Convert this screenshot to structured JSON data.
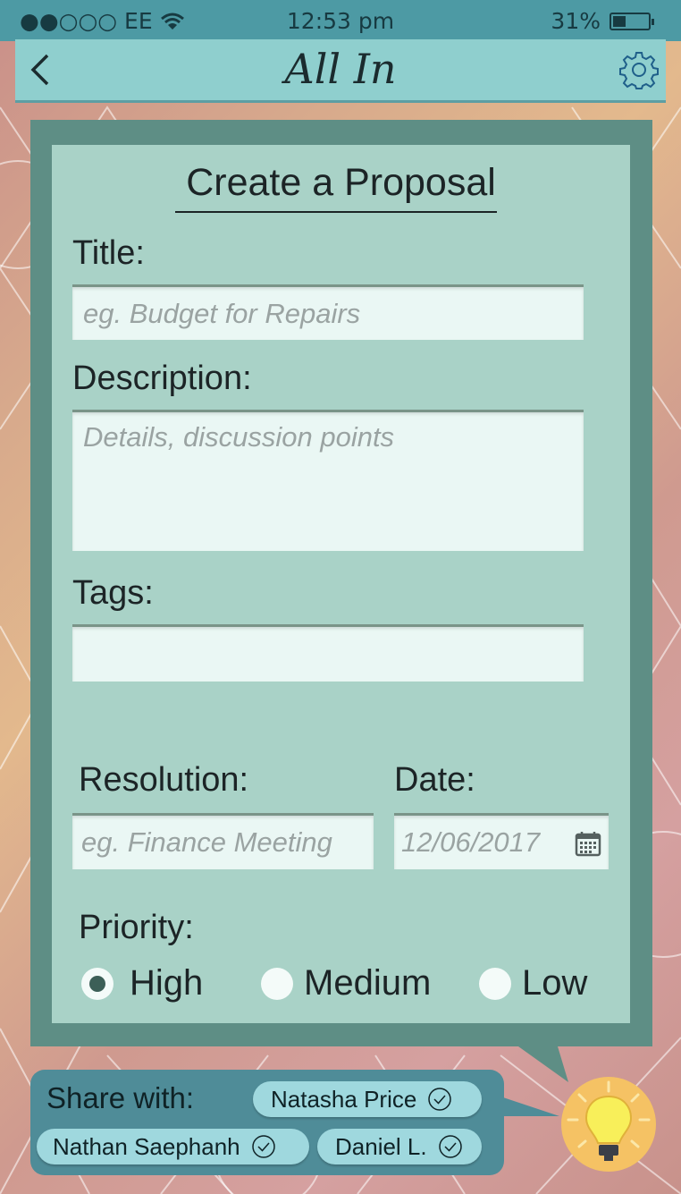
{
  "status_bar": {
    "carrier": "●●○○○ EE",
    "time": "12:53 pm",
    "battery": "31%"
  },
  "nav": {
    "title": "All In",
    "back_icon": "chevron-left-icon",
    "settings_icon": "gear-icon"
  },
  "form": {
    "heading": "Create a Proposal",
    "title_label": "Title:",
    "title_placeholder": "eg. Budget for Repairs",
    "description_label": "Description:",
    "description_placeholder": "Details, discussion points",
    "tags_label": "Tags:",
    "tags_value": "",
    "resolution_label": "Resolution:",
    "resolution_placeholder": "eg. Finance Meeting",
    "date_label": "Date:",
    "date_value": "12/06/2017",
    "priority_label": "Priority:",
    "priority_options": [
      "High",
      "Medium",
      "Low"
    ],
    "priority_selected": "High"
  },
  "share": {
    "label": "Share with:",
    "people": [
      "Natasha Price",
      "Nathan Saephanh",
      "Daniel L."
    ]
  },
  "colors": {
    "accent": "#4d9aa4",
    "card": "#a9d2c7",
    "card_border": "#5e8e85",
    "chip": "#9fd8de",
    "bulb": "#f5c264"
  }
}
